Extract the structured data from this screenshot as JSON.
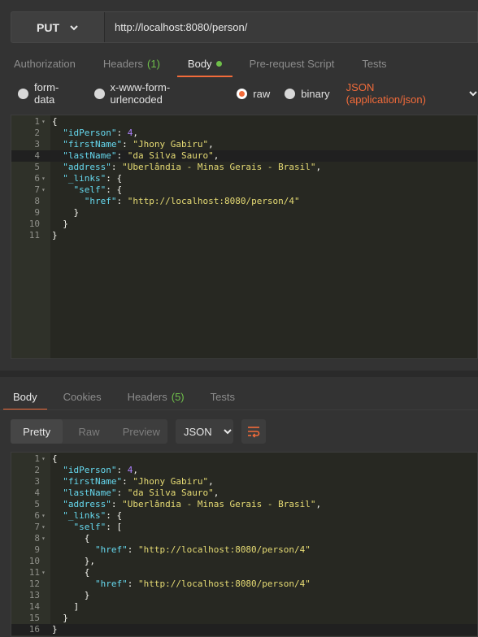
{
  "request": {
    "method": "PUT",
    "url": "http://localhost:8080/person/"
  },
  "request_tabs": [
    {
      "label": "Authorization"
    },
    {
      "label": "Headers",
      "count": "(1)"
    },
    {
      "label": "Body"
    },
    {
      "label": "Pre-request Script"
    },
    {
      "label": "Tests"
    }
  ],
  "body_types": {
    "form_data": "form-data",
    "urlencoded": "x-www-form-urlencoded",
    "raw": "raw",
    "binary": "binary",
    "content_type": "JSON (application/json)"
  },
  "request_body": {
    "line_numbers": [
      "1",
      "2",
      "3",
      "4",
      "5",
      "6",
      "7",
      "8",
      "9",
      "10",
      "11"
    ],
    "lines": [
      [
        {
          "t": "p",
          "v": "{"
        }
      ],
      [
        {
          "t": "p",
          "v": "  "
        },
        {
          "t": "k",
          "v": "\"idPerson\""
        },
        {
          "t": "p",
          "v": ": "
        },
        {
          "t": "n",
          "v": "4"
        },
        {
          "t": "p",
          "v": ","
        }
      ],
      [
        {
          "t": "p",
          "v": "  "
        },
        {
          "t": "k",
          "v": "\"firstName\""
        },
        {
          "t": "p",
          "v": ": "
        },
        {
          "t": "s",
          "v": "\"Jhony Gabiru\""
        },
        {
          "t": "p",
          "v": ","
        }
      ],
      [
        {
          "t": "p",
          "v": "  "
        },
        {
          "t": "k",
          "v": "\"lastName\""
        },
        {
          "t": "p",
          "v": ": "
        },
        {
          "t": "s",
          "v": "\"da Silva Sauro\""
        },
        {
          "t": "p",
          "v": ","
        }
      ],
      [
        {
          "t": "p",
          "v": "  "
        },
        {
          "t": "k",
          "v": "\"address\""
        },
        {
          "t": "p",
          "v": ": "
        },
        {
          "t": "s",
          "v": "\"Uberlândia - Minas Gerais - Brasil\""
        },
        {
          "t": "p",
          "v": ","
        }
      ],
      [
        {
          "t": "p",
          "v": "  "
        },
        {
          "t": "k",
          "v": "\"_links\""
        },
        {
          "t": "p",
          "v": ": {"
        }
      ],
      [
        {
          "t": "p",
          "v": "    "
        },
        {
          "t": "k",
          "v": "\"self\""
        },
        {
          "t": "p",
          "v": ": {"
        }
      ],
      [
        {
          "t": "p",
          "v": "      "
        },
        {
          "t": "k",
          "v": "\"href\""
        },
        {
          "t": "p",
          "v": ": "
        },
        {
          "t": "s",
          "v": "\"http://localhost:8080/person/4\""
        }
      ],
      [
        {
          "t": "p",
          "v": "    }"
        }
      ],
      [
        {
          "t": "p",
          "v": "  }"
        }
      ],
      [
        {
          "t": "p",
          "v": "}"
        }
      ]
    ]
  },
  "response_tabs": [
    {
      "label": "Body"
    },
    {
      "label": "Cookies"
    },
    {
      "label": "Headers",
      "count": "(5)"
    },
    {
      "label": "Tests"
    }
  ],
  "response_toolbar": {
    "pretty": "Pretty",
    "raw": "Raw",
    "preview": "Preview",
    "format": "JSON"
  },
  "response_body": {
    "line_numbers": [
      "1",
      "2",
      "3",
      "4",
      "5",
      "6",
      "7",
      "8",
      "9",
      "10",
      "11",
      "12",
      "13",
      "14",
      "15",
      "16"
    ],
    "lines": [
      [
        {
          "t": "p",
          "v": "{"
        }
      ],
      [
        {
          "t": "p",
          "v": "  "
        },
        {
          "t": "k",
          "v": "\"idPerson\""
        },
        {
          "t": "p",
          "v": ": "
        },
        {
          "t": "n",
          "v": "4"
        },
        {
          "t": "p",
          "v": ","
        }
      ],
      [
        {
          "t": "p",
          "v": "  "
        },
        {
          "t": "k",
          "v": "\"firstName\""
        },
        {
          "t": "p",
          "v": ": "
        },
        {
          "t": "s",
          "v": "\"Jhony Gabiru\""
        },
        {
          "t": "p",
          "v": ","
        }
      ],
      [
        {
          "t": "p",
          "v": "  "
        },
        {
          "t": "k",
          "v": "\"lastName\""
        },
        {
          "t": "p",
          "v": ": "
        },
        {
          "t": "s",
          "v": "\"da Silva Sauro\""
        },
        {
          "t": "p",
          "v": ","
        }
      ],
      [
        {
          "t": "p",
          "v": "  "
        },
        {
          "t": "k",
          "v": "\"address\""
        },
        {
          "t": "p",
          "v": ": "
        },
        {
          "t": "s",
          "v": "\"Uberlândia - Minas Gerais - Brasil\""
        },
        {
          "t": "p",
          "v": ","
        }
      ],
      [
        {
          "t": "p",
          "v": "  "
        },
        {
          "t": "k",
          "v": "\"_links\""
        },
        {
          "t": "p",
          "v": ": {"
        }
      ],
      [
        {
          "t": "p",
          "v": "    "
        },
        {
          "t": "k",
          "v": "\"self\""
        },
        {
          "t": "p",
          "v": ": ["
        }
      ],
      [
        {
          "t": "p",
          "v": "      {"
        }
      ],
      [
        {
          "t": "p",
          "v": "        "
        },
        {
          "t": "k",
          "v": "\"href\""
        },
        {
          "t": "p",
          "v": ": "
        },
        {
          "t": "s",
          "v": "\"http://localhost:8080/person/4\""
        }
      ],
      [
        {
          "t": "p",
          "v": "      },"
        }
      ],
      [
        {
          "t": "p",
          "v": "      {"
        }
      ],
      [
        {
          "t": "p",
          "v": "        "
        },
        {
          "t": "k",
          "v": "\"href\""
        },
        {
          "t": "p",
          "v": ": "
        },
        {
          "t": "s",
          "v": "\"http://localhost:8080/person/4\""
        }
      ],
      [
        {
          "t": "p",
          "v": "      }"
        }
      ],
      [
        {
          "t": "p",
          "v": "    ]"
        }
      ],
      [
        {
          "t": "p",
          "v": "  }"
        }
      ],
      [
        {
          "t": "p",
          "v": "}"
        }
      ]
    ]
  },
  "colors": {
    "accent": "#f26b3a",
    "count_green": "#6fbf4a",
    "editor_bg": "#272822"
  }
}
